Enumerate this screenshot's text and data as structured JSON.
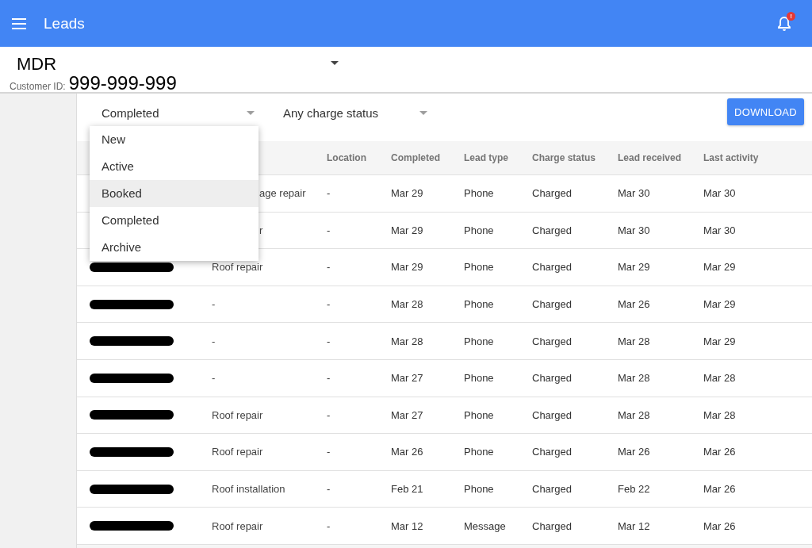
{
  "app_bar": {
    "title": "Leads",
    "notification_badge": "!"
  },
  "account": {
    "name": "MDR",
    "id_label": "Customer ID:",
    "id": "999-999-999"
  },
  "filters": [
    {
      "value": "Completed"
    },
    {
      "value": "Any charge status"
    }
  ],
  "download_button": "DOWNLOAD",
  "status_menu": [
    {
      "label": "New",
      "selected": false
    },
    {
      "label": "Active",
      "selected": false
    },
    {
      "label": "Booked",
      "selected": true
    },
    {
      "label": "Completed",
      "selected": false
    },
    {
      "label": "Archive",
      "selected": false
    }
  ],
  "table": {
    "columns": [
      "Location",
      "Completed",
      "Lead type",
      "Charge status",
      "Lead received",
      "Last activity"
    ],
    "rows": [
      {
        "service": "age repair",
        "location": "-",
        "completed": "Mar 29",
        "lead_type": "Phone",
        "charge_status": "Charged",
        "received": "Mar 30",
        "last_activity": "Mar 30"
      },
      {
        "service": "r",
        "location": "-",
        "completed": "Mar 29",
        "lead_type": "Phone",
        "charge_status": "Charged",
        "received": "Mar 30",
        "last_activity": "Mar 30"
      },
      {
        "service": "Roof repair",
        "location": "-",
        "completed": "Mar 29",
        "lead_type": "Phone",
        "charge_status": "Charged",
        "received": "Mar 29",
        "last_activity": "Mar 29"
      },
      {
        "service": "-",
        "location": "-",
        "completed": "Mar 28",
        "lead_type": "Phone",
        "charge_status": "Charged",
        "received": "Mar 26",
        "last_activity": "Mar 29"
      },
      {
        "service": "-",
        "location": "-",
        "completed": "Mar 28",
        "lead_type": "Phone",
        "charge_status": "Charged",
        "received": "Mar 28",
        "last_activity": "Mar 29"
      },
      {
        "service": "-",
        "location": "-",
        "completed": "Mar 27",
        "lead_type": "Phone",
        "charge_status": "Charged",
        "received": "Mar 28",
        "last_activity": "Mar 28"
      },
      {
        "service": "Roof repair",
        "location": "-",
        "completed": "Mar 27",
        "lead_type": "Phone",
        "charge_status": "Charged",
        "received": "Mar 28",
        "last_activity": "Mar 28"
      },
      {
        "service": "Roof repair",
        "location": "-",
        "completed": "Mar 26",
        "lead_type": "Phone",
        "charge_status": "Charged",
        "received": "Mar 26",
        "last_activity": "Mar 26"
      },
      {
        "service": "Roof installation",
        "location": "-",
        "completed": "Feb 21",
        "lead_type": "Phone",
        "charge_status": "Charged",
        "received": "Feb 22",
        "last_activity": "Mar 26"
      },
      {
        "service": "Roof repair",
        "location": "-",
        "completed": "Mar 12",
        "lead_type": "Message",
        "charge_status": "Charged",
        "received": "Mar 12",
        "last_activity": "Mar 26"
      }
    ]
  }
}
